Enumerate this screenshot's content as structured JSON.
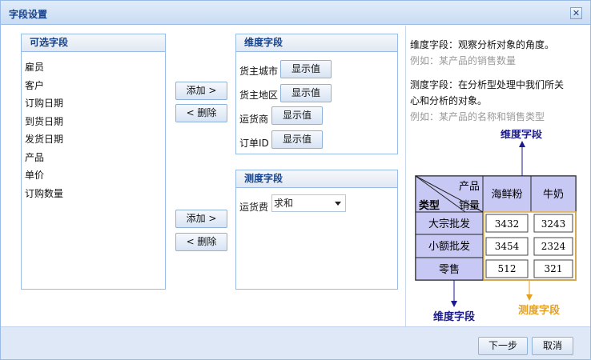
{
  "window": {
    "title": "字段设置",
    "close_icon": "close-icon"
  },
  "available_fields": {
    "header": "可选字段",
    "items": [
      "雇员",
      "客户",
      "订购日期",
      "到货日期",
      "发货日期",
      "产品",
      "单价",
      "订购数量"
    ]
  },
  "transfer": {
    "add_label": "添加 >",
    "remove_label": "< 删除"
  },
  "dimension_fields": {
    "header": "维度字段",
    "show_value_label": "显示值",
    "items": [
      "货主城市",
      "货主地区",
      "运货商",
      "订单ID"
    ]
  },
  "measure_fields": {
    "header": "测度字段",
    "items": [
      {
        "label": "运货费",
        "aggregate": "求和"
      }
    ]
  },
  "help": {
    "dimension_desc": "维度字段：观察分析对象的角度。",
    "dimension_example": "例如：某产品的销售数量",
    "measure_desc_1": "测度字段：在分析型处理中我们所关",
    "measure_desc_2": "心和分析的对象。",
    "measure_example": "例如：某产品的名称和销售类型"
  },
  "illustration": {
    "top_label": "维度字段",
    "corner_top": "产品",
    "corner_bottom_left": "类型",
    "corner_bottom_right": "销量",
    "col_headers": [
      "海鲜粉",
      "牛奶"
    ],
    "row_headers": [
      "大宗批发",
      "小额批发",
      "零售"
    ],
    "cells": [
      [
        "3432",
        "3243"
      ],
      [
        "3454",
        "2324"
      ],
      [
        "512",
        "321"
      ]
    ],
    "bottom_left_label": "维度字段",
    "bottom_right_label": "测度字段",
    "colors": {
      "header_fill": "#c8c8f5",
      "dim_label": "#1a1a8c",
      "measure_label": "#e6a020",
      "measure_box": "#e6b040"
    }
  },
  "footer": {
    "next_label": "下一步",
    "cancel_label": "取消"
  }
}
